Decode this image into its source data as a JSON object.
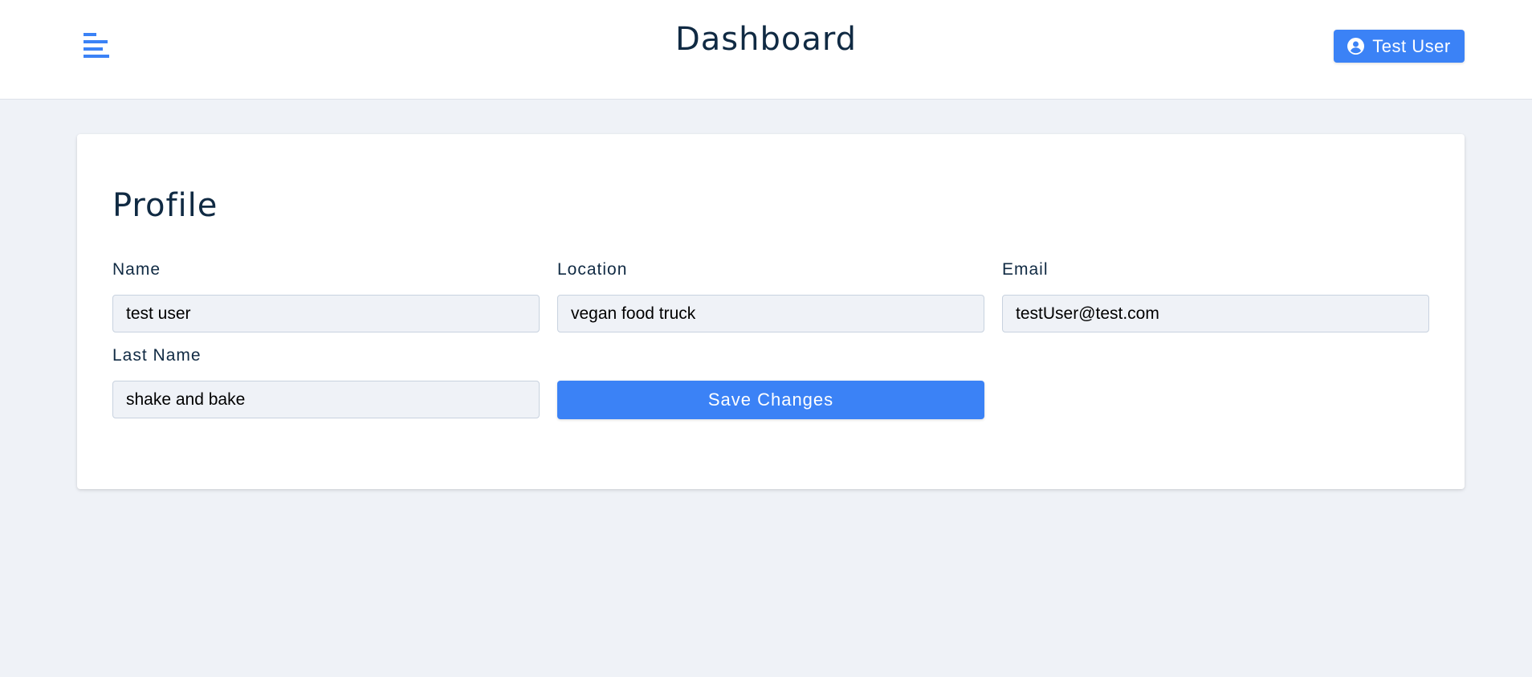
{
  "header": {
    "menu_icon": "menu-icon",
    "title": "Dashboard",
    "user_button": {
      "icon": "user-circle-icon",
      "label": "Test User"
    }
  },
  "profile": {
    "title": "Profile",
    "fields": {
      "name": {
        "label": "Name",
        "value": "test user"
      },
      "location": {
        "label": "Location",
        "value": "vegan food truck"
      },
      "email": {
        "label": "Email",
        "value": "testUser@test.com"
      },
      "last_name": {
        "label": "Last Name",
        "value": "shake and bake"
      }
    },
    "save_label": "Save Changes"
  },
  "colors": {
    "accent": "#3b82f6",
    "background": "#eff2f7",
    "text_dark": "#102a43"
  }
}
